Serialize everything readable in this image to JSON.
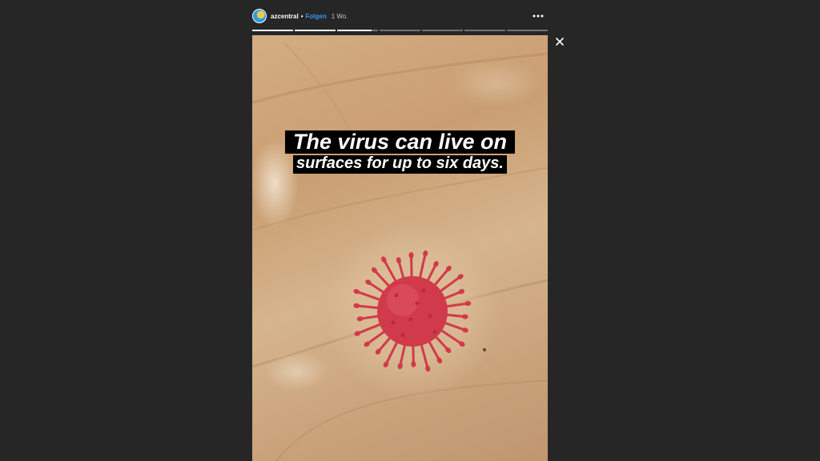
{
  "header": {
    "username": "azcentral",
    "separator": "•",
    "follow_label": "Folgen",
    "time_ago": "1 Wo."
  },
  "progress": {
    "segments": 7,
    "active_index": 2,
    "active_fraction": 0.85
  },
  "story": {
    "caption_line_1": "The virus can live on",
    "caption_line_2": "surfaces for up to six days."
  },
  "icons": {
    "more": "more-options-icon",
    "close": "close-icon",
    "avatar": "avatar"
  },
  "colors": {
    "background": "#262626",
    "follow": "#3897f0",
    "virus": "#d13a4a"
  }
}
